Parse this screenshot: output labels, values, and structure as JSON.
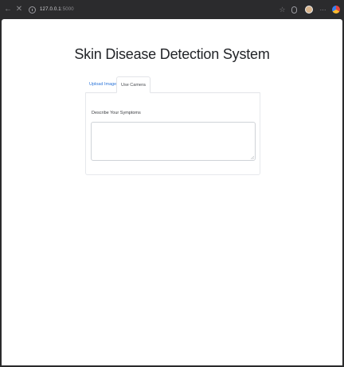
{
  "browser": {
    "url_host": "127.0.0.1",
    "url_path": ":5000",
    "icons": [
      "back-icon",
      "close-icon",
      "info-icon",
      "star-icon",
      "extension-icon",
      "avatar-icon",
      "menu-dots-icon",
      "chrome-icon"
    ]
  },
  "page": {
    "title": "Skin Disease Detection System"
  },
  "tabs": [
    {
      "label": "Upload Image",
      "active": false
    },
    {
      "label": "Use Camera",
      "active": true
    }
  ],
  "form": {
    "symptoms_label": "Describe Your Symptoms",
    "symptoms_value": "",
    "symptoms_placeholder": ""
  },
  "colors": {
    "link": "#2b74d9",
    "title": "#222428",
    "browser_bar": "#2b2b2d"
  }
}
